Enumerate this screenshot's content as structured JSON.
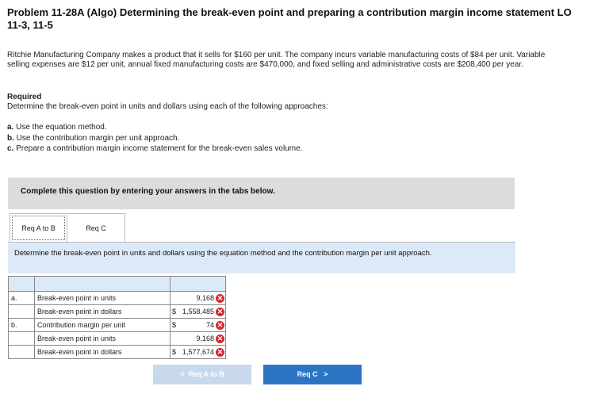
{
  "problem": {
    "title": "Problem 11-28A (Algo) Determining the break-even point and preparing a contribution margin income statement LO 11-3, 11-5",
    "paragraph": "Ritchie Manufacturing Company makes a product that it sells for $160 per unit. The company incurs variable manufacturing costs of $84 per unit. Variable selling expenses are $12 per unit, annual fixed manufacturing costs are $470,000, and fixed selling and administrative costs are $208,400 per year.",
    "required_heading": "Required",
    "required_desc": "Determine the break-even point in units and dollars using each of the following approaches:",
    "items": [
      {
        "letter": "a.",
        "text": "Use the equation method."
      },
      {
        "letter": "b.",
        "text": "Use the contribution margin per unit approach."
      },
      {
        "letter": "c.",
        "text": "Prepare a contribution margin income statement for the break-even sales volume."
      }
    ]
  },
  "banner": "Complete this question by entering your answers in the tabs below.",
  "tabs": [
    {
      "label": "Req A to B",
      "active": true
    },
    {
      "label": "Req C",
      "active": false
    }
  ],
  "instruction": "Determine the break-even point in units and dollars using the equation method and the contribution margin per unit approach.",
  "table": {
    "rows": [
      {
        "letter": "a.",
        "label": "Break-even point in units",
        "currency": "",
        "value": "9,168"
      },
      {
        "letter": "",
        "label": "Break-even point in dollars",
        "currency": "$",
        "value": "1,558,485"
      },
      {
        "letter": "b.",
        "label": "Contribution margin per unit",
        "currency": "$",
        "value": "74"
      },
      {
        "letter": "",
        "label": "Break-even point in units",
        "currency": "",
        "value": "9,168"
      },
      {
        "letter": "",
        "label": "Break-even point in dollars",
        "currency": "$",
        "value": "1,577,674"
      }
    ],
    "status_icon": "incorrect-x-icon",
    "status_color": "#d7262e"
  },
  "nav": {
    "prev_label": "Req A to B",
    "next_label": "Req C"
  }
}
